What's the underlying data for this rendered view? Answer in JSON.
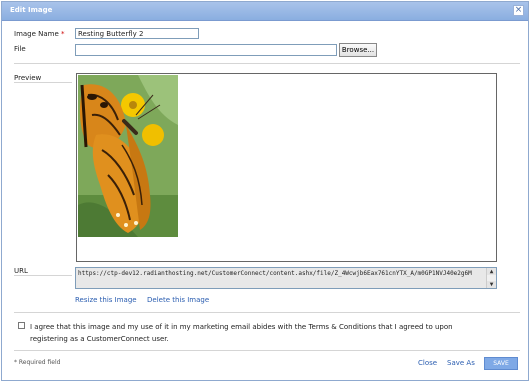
{
  "dialog": {
    "title": "Edit Image",
    "close_glyph": "×"
  },
  "form": {
    "image_name_label": "Image Name",
    "required_marker": "*",
    "image_name_value": "Resting Butterfly 2",
    "file_label": "File",
    "file_value": "",
    "browse_label": "Browse...",
    "preview_label": "Preview",
    "url_label": "URL",
    "url_value": "https://ctp-dev12.radianthosting.net/CustomerConnect/content.ashx/file/Z_4Wcwjb6Eax761cnYTX_A/m0GP1NVJ40e2g6M",
    "resize_link": "Resize this Image",
    "delete_link": "Delete this Image",
    "agree_text": "I agree that this image and my use of it in my marketing email abides with the Terms & Conditions that I agreed to upon registering as a CustomerConnect user."
  },
  "footer": {
    "required_note": "* Required field",
    "close_link": "Close",
    "save_as_link": "Save As",
    "save_button": "SAVE"
  },
  "colors": {
    "titlebar": "#8aaee0",
    "link": "#2a5db0",
    "save_button": "#7fa9e6"
  },
  "icons": {
    "close": "close-icon",
    "scroll_up": "scroll-up-icon",
    "scroll_down": "scroll-down-icon"
  }
}
